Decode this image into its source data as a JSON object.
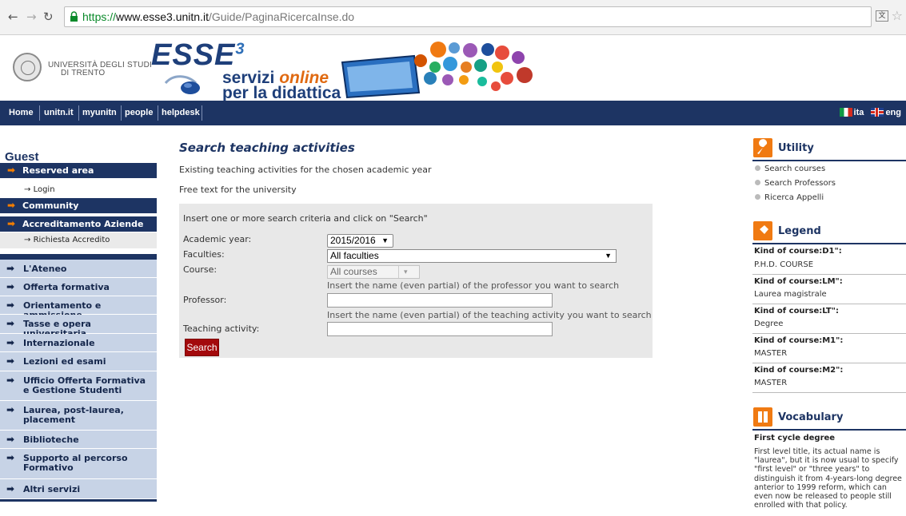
{
  "browser": {
    "url_scheme": "https://",
    "url_host": "www.esse3.unitn.it",
    "url_path": "/Guide/PaginaRicercaInse.do"
  },
  "header": {
    "university_line1": "UNIVERSITÀ DEGLI STUDI",
    "university_line2": "DI TRENTO",
    "esse_text": "ESSE",
    "esse_sup": "3",
    "tagline_1": "servizi ",
    "tagline_online": "online",
    "tagline_2": "per la didattica"
  },
  "topnav": {
    "items": [
      "Home",
      "unitn.it",
      "myunitn",
      "people",
      "helpdesk"
    ],
    "lang_it": "ita",
    "lang_en": "eng"
  },
  "sidebar": {
    "guest": "Guest",
    "reserved_area": "Reserved area",
    "login": "Login",
    "community": "Community",
    "accreditamento": "Accreditamento Aziende",
    "richiesta": "Richiesta Accredito",
    "menu": [
      "L'Ateneo",
      "Offerta formativa",
      "Orientamento e ammissione",
      "Tasse e opera universitaria",
      "Internazionale",
      "Lezioni ed esami",
      "Ufficio Offerta Formativa e Gestione Studenti",
      "Laurea, post-laurea, placement",
      "Biblioteche",
      "Supporto al percorso Formativo",
      "Altri servizi"
    ]
  },
  "main": {
    "title": "Search teaching activities",
    "subtitle1": "Existing teaching activities for the chosen academic year",
    "subtitle2": "Free text for the university",
    "instructions": "Insert one or more search criteria and click on \"Search\"",
    "academic_year_label": "Academic year:",
    "academic_year_value": "2015/2016",
    "faculties_label": "Faculties:",
    "faculties_value": "All faculties",
    "course_label": "Course:",
    "course_value": "All courses",
    "professor_hint": "Insert the name (even partial) of the professor you want to search",
    "professor_label": "Professor:",
    "professor_value": "",
    "activity_hint": "Insert the name (even partial) of the teaching activity you want to search",
    "activity_label": "Teaching activity:",
    "activity_value": "",
    "search_button": "Search"
  },
  "right": {
    "utility_title": "Utility",
    "utility_links": [
      "Search courses",
      "Search Professors",
      "Ricerca Appelli"
    ],
    "legend_title": "Legend",
    "legend": [
      {
        "key": "Kind of course:D1\":",
        "value": "P.H.D. COURSE"
      },
      {
        "key": "Kind of course:LM\":",
        "value": "Laurea magistrale"
      },
      {
        "key": "Kind of course:LT\":",
        "value": "Degree"
      },
      {
        "key": "Kind of course:M1\":",
        "value": "MASTER"
      },
      {
        "key": "Kind of course:M2\":",
        "value": "MASTER"
      }
    ],
    "vocabulary_title": "Vocabulary",
    "vocab_term": "First cycle degree",
    "vocab_def": "First level title, its actual name is \"laurea\", but it is now usual to specify \"first level\" or \"three years\" to distinguish it from 4-years-long degree anterior to 1999 reform, which can even now be released to people still enrolled with that policy."
  },
  "icons": {
    "back": "back-arrow-icon",
    "forward": "forward-arrow-icon",
    "reload": "reload-icon",
    "lock": "lock-icon",
    "translate": "translate-icon",
    "bookmark": "star-icon",
    "nav_arrow": "right-arrow-icon",
    "utility": "wrench-icon",
    "legend": "pin-icon",
    "vocabulary": "book-icon"
  },
  "colors": {
    "nav_blue": "#1d3463",
    "accent_orange": "#f07a12",
    "search_red": "#a3090c",
    "menu_light_blue": "#c7d3e6",
    "form_gray": "#e8e8e8"
  }
}
